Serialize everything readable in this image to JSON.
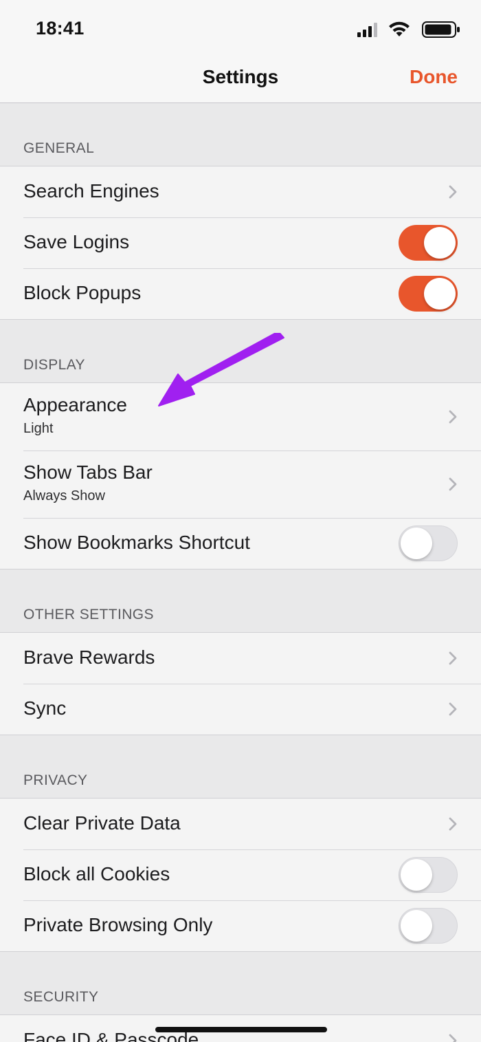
{
  "status_bar": {
    "time": "18:41"
  },
  "nav": {
    "title": "Settings",
    "done_label": "Done"
  },
  "sections": {
    "general": {
      "header": "GENERAL",
      "search_engines": "Search Engines",
      "save_logins": "Save Logins",
      "block_popups": "Block Popups"
    },
    "display": {
      "header": "DISPLAY",
      "appearance": "Appearance",
      "appearance_value": "Light",
      "show_tabs_bar": "Show Tabs Bar",
      "show_tabs_bar_value": "Always Show",
      "show_bookmarks_shortcut": "Show Bookmarks Shortcut"
    },
    "other_settings": {
      "header": "OTHER SETTINGS",
      "brave_rewards": "Brave Rewards",
      "sync": "Sync"
    },
    "privacy": {
      "header": "PRIVACY",
      "clear_private_data": "Clear Private Data",
      "block_all_cookies": "Block all Cookies",
      "private_browsing_only": "Private Browsing Only"
    },
    "security": {
      "header": "SECURITY",
      "face_id_passcode": "Face ID & Passcode"
    }
  },
  "toggles": {
    "save_logins": true,
    "block_popups": true,
    "show_bookmarks_shortcut": false,
    "block_all_cookies": false,
    "private_browsing_only": false
  },
  "colors": {
    "accent": "#e8562c",
    "annotation_arrow": "#a020f0",
    "background": "#e9e9ea",
    "cell": "#f4f4f4"
  },
  "icons": {
    "chevron": "chevron-right-icon",
    "signal": "cellular-signal-icon",
    "wifi": "wifi-icon",
    "battery": "battery-icon"
  }
}
